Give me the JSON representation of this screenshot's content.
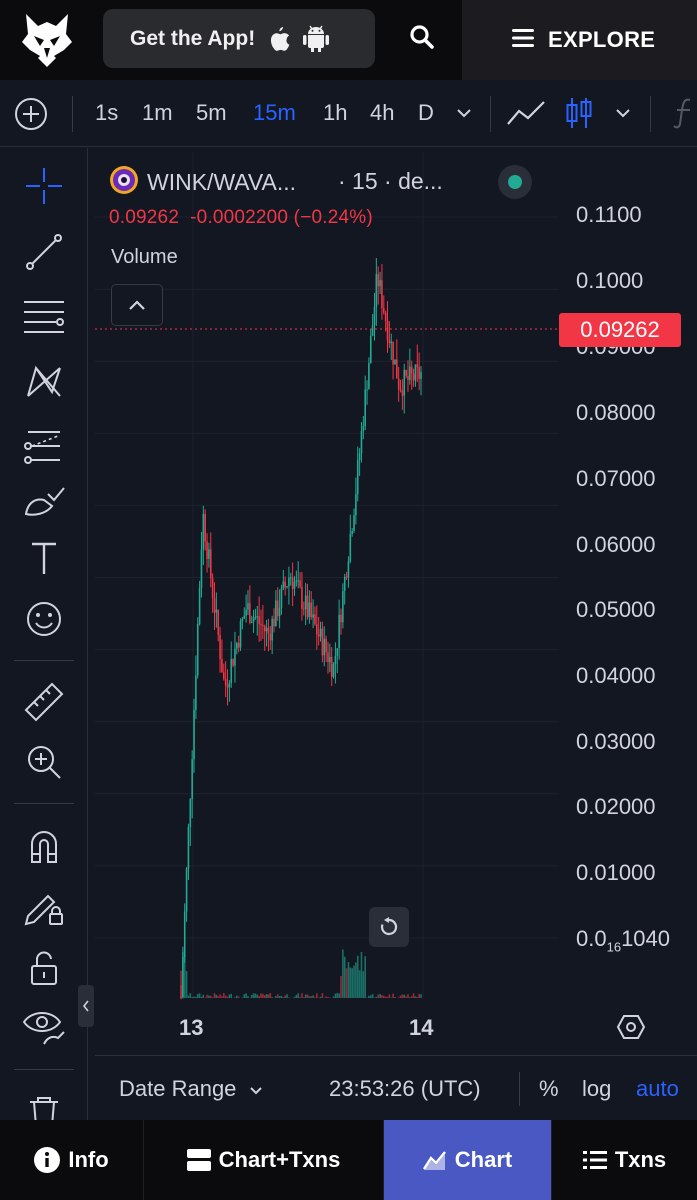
{
  "header": {
    "get_app_label": "Get the App!",
    "explore_label": "EXPLORE"
  },
  "toolbar": {
    "timeframes": [
      "1s",
      "1m",
      "5m",
      "15m",
      "1h",
      "4h",
      "D"
    ],
    "active_timeframe": "15m"
  },
  "chart": {
    "pair": "WINK/WAVA...",
    "interval_and_source": "· 15 · de...",
    "ohlc_price": "0.09262",
    "ohlc_change": "-0.0002200 (−0.24%)",
    "volume_label": "Volume",
    "current_price_label": "0.09262",
    "y_axis_labels": [
      "0.1100",
      "0.1000",
      "0.09000",
      "0.08000",
      "0.07000",
      "0.06000",
      "0.05000",
      "0.04000",
      "0.03000",
      "0.02000",
      "0.01000"
    ],
    "y_axis_bottom_prefix": "0.0",
    "y_axis_bottom_sub": "16",
    "y_axis_bottom_suffix": "1040",
    "x_axis_labels": [
      "13",
      "14"
    ],
    "colors": {
      "up": "#22ab94",
      "down": "#f23645",
      "accent": "#2962ff",
      "background": "#131722"
    }
  },
  "chart_data": {
    "type": "candlestick",
    "ylim": [
      0,
      0.115
    ],
    "x_axis_ticks": [
      "13",
      "14"
    ],
    "last_price": 0.09262,
    "price_path_approx": [
      0.0002,
      0.072,
      0.046,
      0.058,
      0.054,
      0.063,
      0.056,
      0.049,
      0.075,
      0.107,
      0.091,
      0.0926
    ]
  },
  "range_bar": {
    "date_range_label": "Date Range",
    "time_label": "23:53:26 (UTC)",
    "percent_label": "%",
    "log_label": "log",
    "auto_label": "auto"
  },
  "bottom_nav": {
    "info": "Info",
    "chart_txns": "Chart+Txns",
    "chart": "Chart",
    "txns": "Txns"
  }
}
